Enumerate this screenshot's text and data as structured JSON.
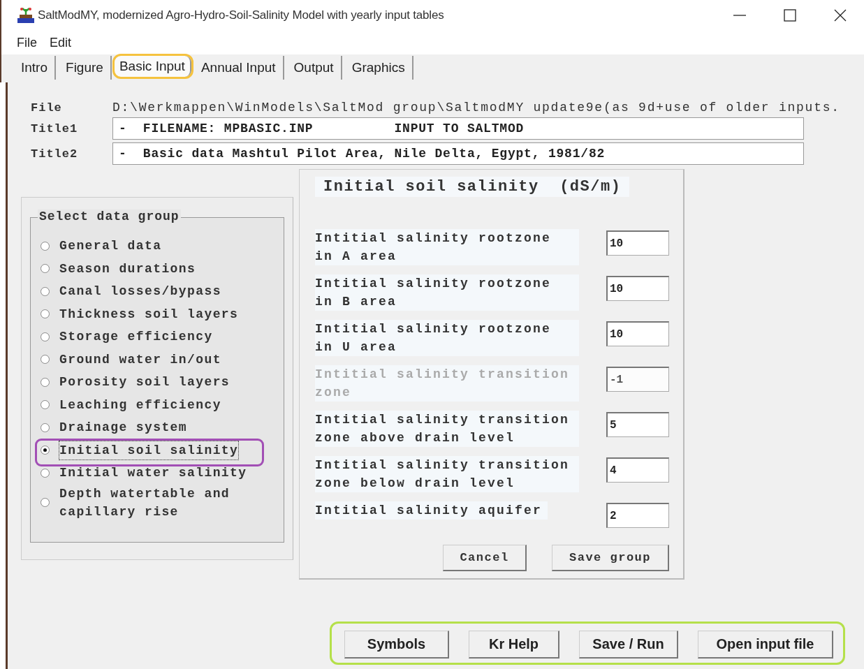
{
  "window": {
    "title": "SaltModMY, modernized Agro-Hydro-Soil-Salinity Model with yearly input tables"
  },
  "menu": [
    "File",
    "Edit"
  ],
  "tabs": [
    {
      "label": "Intro",
      "selected": false,
      "highlighted": false
    },
    {
      "label": "Figure",
      "selected": false,
      "highlighted": false
    },
    {
      "label": "Basic Input",
      "selected": true,
      "highlighted": true
    },
    {
      "label": "Annual Input",
      "selected": false,
      "highlighted": false
    },
    {
      "label": "Output",
      "selected": false,
      "highlighted": false
    },
    {
      "label": "Graphics",
      "selected": false,
      "highlighted": false
    }
  ],
  "file": {
    "label": "File",
    "value": "D:\\Werkmappen\\WinModels\\SaltMod group\\SaltmodMY update9e(as 9d+use of older inputs."
  },
  "titles": [
    {
      "label": "Title1",
      "value": "-  FILENAME: MPBASIC.INP          INPUT TO SALTMOD"
    },
    {
      "label": "Title2",
      "value": "-  Basic data Mashtul Pilot Area, Nile Delta, Egypt, 1981/82"
    }
  ],
  "data_group": {
    "title": "Select data group",
    "options": [
      {
        "label": "General data",
        "selected": false
      },
      {
        "label": "Season durations",
        "selected": false
      },
      {
        "label": "Canal losses/bypass",
        "selected": false
      },
      {
        "label": "Thickness soil layers",
        "selected": false
      },
      {
        "label": "Storage efficiency",
        "selected": false
      },
      {
        "label": "Ground water in/out",
        "selected": false
      },
      {
        "label": "Porosity soil layers",
        "selected": false
      },
      {
        "label": "Leaching efficiency",
        "selected": false
      },
      {
        "label": "Drainage system",
        "selected": false
      },
      {
        "label": "Initial soil salinity",
        "selected": true,
        "highlighted": true
      },
      {
        "label": "Initial water salinity",
        "selected": false
      },
      {
        "label": "Depth watertable and capillary rise",
        "selected": false
      }
    ]
  },
  "form": {
    "title": "Initial soil salinity  (dS/m)",
    "fields": [
      {
        "label": "Intitial salinity rootzone in A area",
        "value": "10",
        "disabled": false
      },
      {
        "label": "Intitial salinity rootzone in B area",
        "value": "10",
        "disabled": false
      },
      {
        "label": "Intitial salinity rootzone in U area",
        "value": "10",
        "disabled": false
      },
      {
        "label": "Intitial salinity transition zone",
        "value": "-1",
        "disabled": true
      },
      {
        "label": "Intitial salinity transition zone above drain level",
        "value": "5",
        "disabled": false
      },
      {
        "label": "Intitial salinity transition zone below drain level",
        "value": "4",
        "disabled": false
      },
      {
        "label": "Intitial salinity aquifer",
        "value": "2",
        "disabled": false
      }
    ],
    "buttons": [
      "Cancel",
      "Save group"
    ]
  },
  "bottom_buttons": {
    "highlighted": true,
    "buttons": [
      "Symbols",
      "Kr Help",
      "Save / Run",
      "Open input file"
    ]
  }
}
